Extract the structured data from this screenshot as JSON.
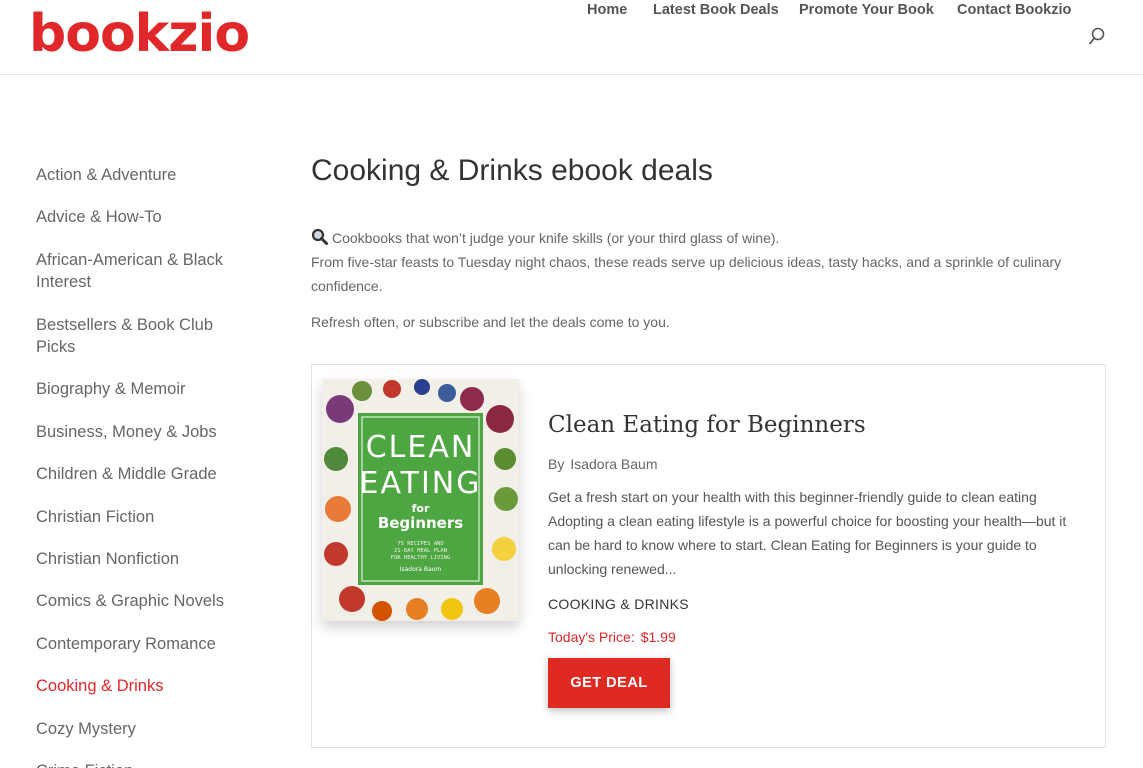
{
  "header": {
    "logo": "bookzio",
    "nav": [
      "Home",
      "Latest Book Deals",
      "Promote Your Book",
      "Contact Bookzio"
    ],
    "search_icon": "search-icon"
  },
  "sidebar": {
    "items": [
      "Action & Adventure",
      "Advice & How-To",
      "African-American & Black Interest",
      "Bestsellers & Book Club Picks",
      "Biography & Memoir",
      "Business, Money & Jobs",
      "Children & Middle Grade",
      "Christian Fiction",
      "Christian Nonfiction",
      "Comics & Graphic Novels",
      "Contemporary Romance",
      "Cooking & Drinks",
      "Cozy Mystery",
      "Crime Fiction"
    ],
    "active_index": 11
  },
  "main": {
    "title": "Cooking & Drinks ebook deals",
    "intro_line1": "Cookbooks that won’t judge your knife skills (or your third glass of wine).",
    "intro_line2": "From five-star feasts to Tuesday night chaos, these reads serve up delicious ideas, tasty hacks, and a sprinkle of culinary confidence.",
    "refresh": "Refresh often, or subscribe and let the deals come to you."
  },
  "book": {
    "title": "Clean Eating for Beginners",
    "by_label": "By",
    "author": "Isadora Baum",
    "description": "Get a fresh start on your health with this beginner-friendly guide to clean eating Adopting a clean eating lifestyle is a powerful choice for boosting your health—but it can be hard to know where to start. Clean Eating for Beginners is your guide to unlocking renewed...",
    "category": "COOKING & DRINKS",
    "price_label": "Today's Price:",
    "price": "$1.99",
    "button": "GET DEAL",
    "cover": {
      "line1": "CLEAN",
      "line2": "EATING",
      "line3": "for",
      "line4": "Beginners",
      "sub1": "75 RECIPES AND",
      "sub2": "21-DAY MEAL PLAN",
      "sub3": "FOR HEALTHY LIVING",
      "author": "Isadora Baum"
    }
  },
  "colors": {
    "brand": "#e0282a",
    "button": "#df2a24",
    "cover_green": "#4ea642"
  }
}
